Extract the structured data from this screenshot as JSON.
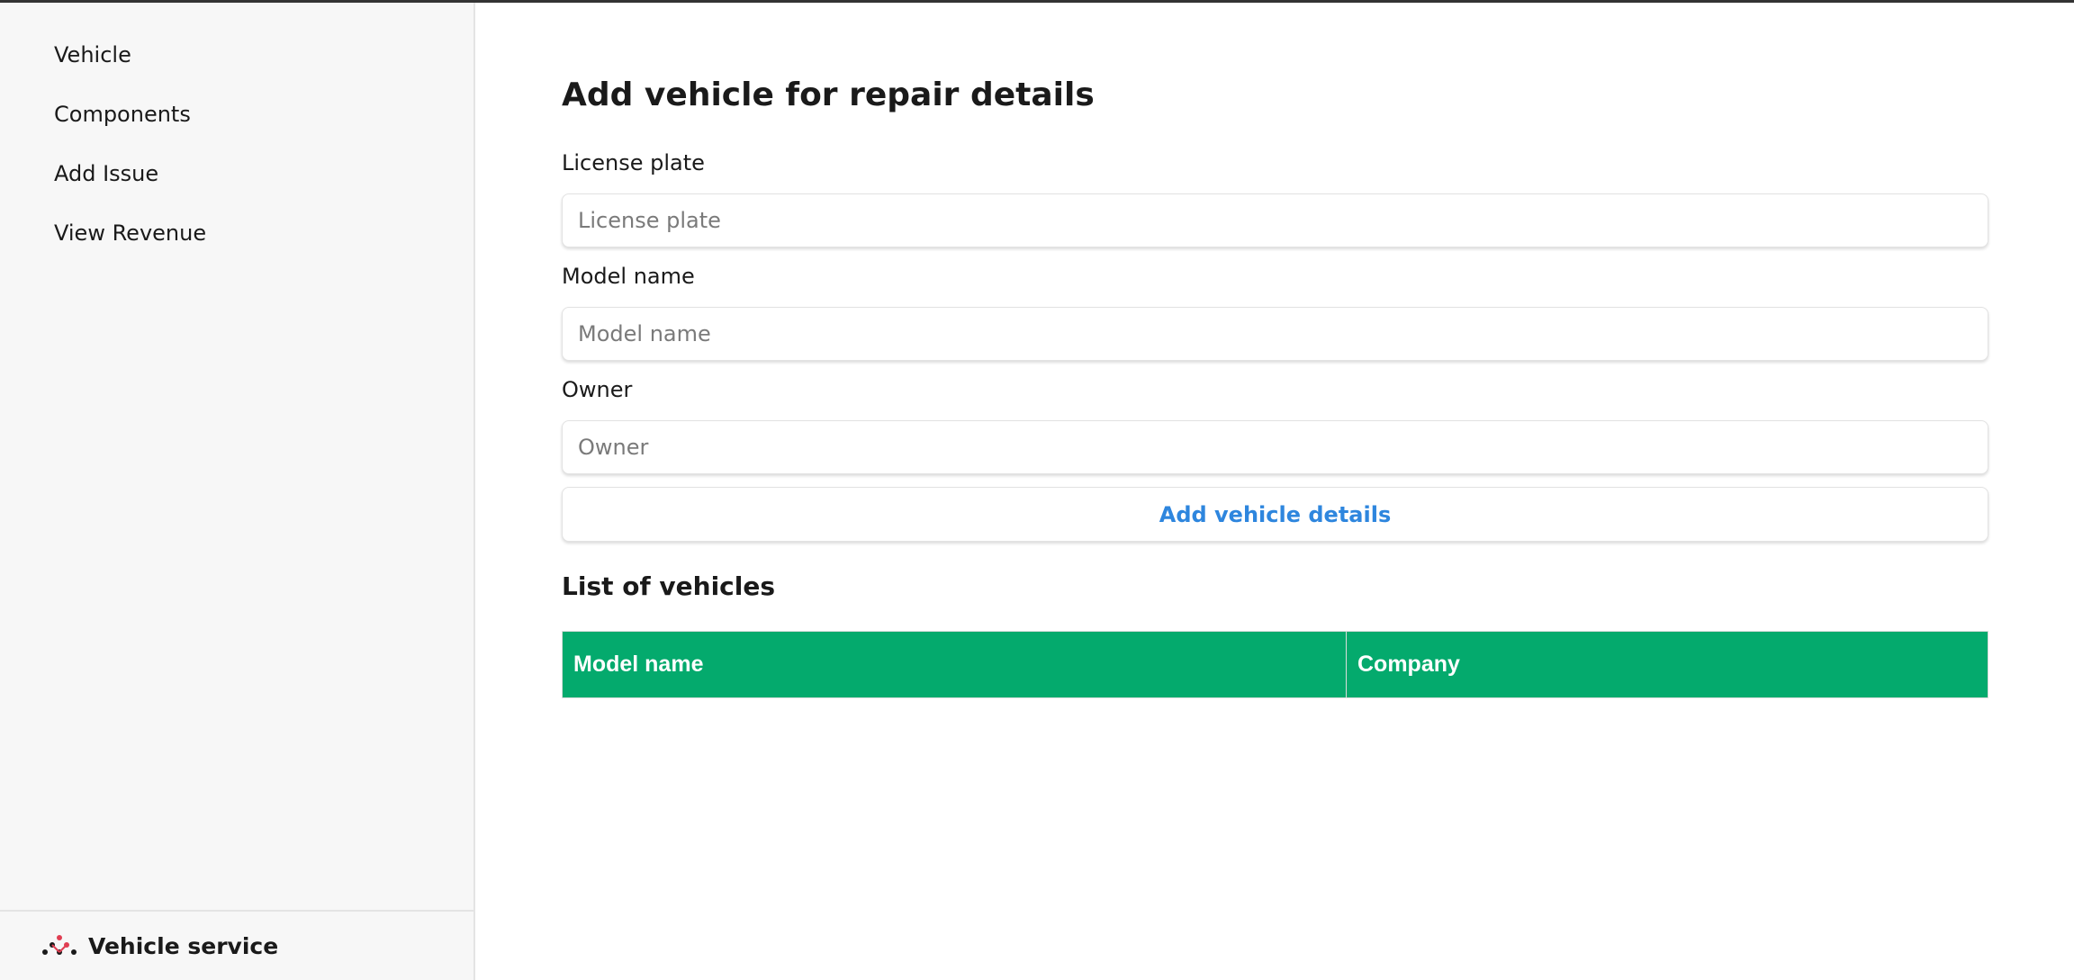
{
  "sidebar": {
    "items": [
      {
        "label": "Vehicle"
      },
      {
        "label": "Components"
      },
      {
        "label": "Add Issue"
      },
      {
        "label": "View Revenue"
      }
    ],
    "brand": "Vehicle service",
    "logo_colors": {
      "dark": "#1a1a1a",
      "accent": "#e03e52"
    }
  },
  "main": {
    "title": "Add vehicle for repair details",
    "fields": [
      {
        "label": "License plate",
        "placeholder": "License plate",
        "value": ""
      },
      {
        "label": "Model name",
        "placeholder": "Model name",
        "value": ""
      },
      {
        "label": "Owner",
        "placeholder": "Owner",
        "value": ""
      }
    ],
    "add_button_label": "Add vehicle details",
    "list_title": "List of vehicles",
    "table": {
      "columns": [
        "Model name",
        "Company"
      ],
      "rows": [],
      "header_color": "#04aa6d"
    }
  },
  "colors": {
    "link": "#2e86de",
    "sidebar_bg": "#f7f7f7"
  }
}
